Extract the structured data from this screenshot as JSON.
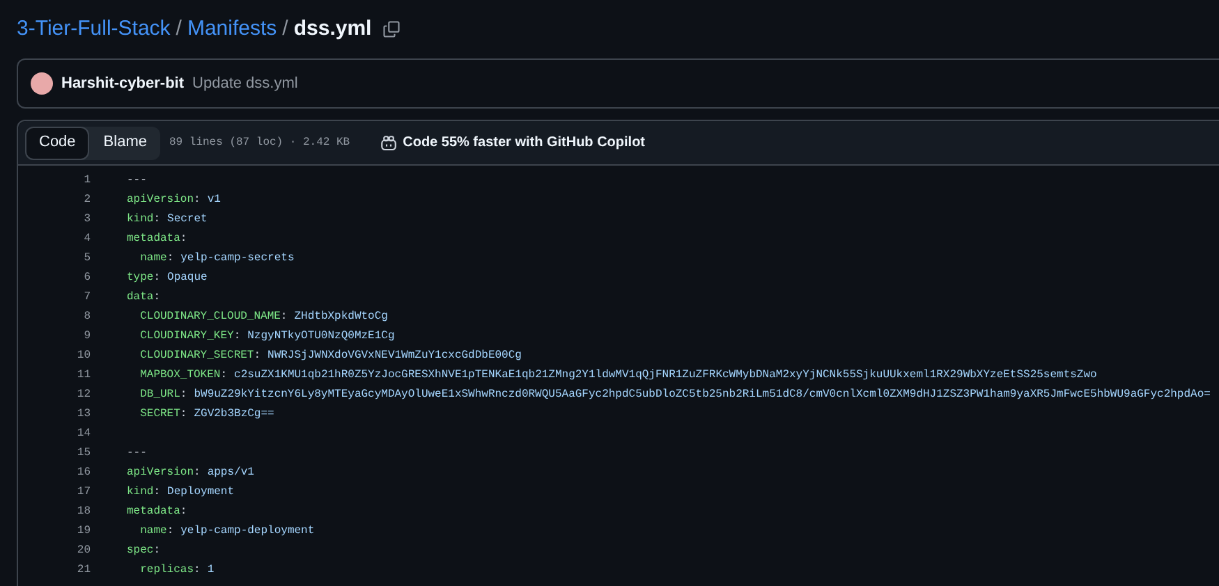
{
  "breadcrumb": [
    {
      "label": "3-Tier-Full-Stack",
      "kind": "link"
    },
    {
      "label": "/",
      "kind": "separator"
    },
    {
      "label": "Manifests",
      "kind": "link"
    },
    {
      "label": "/",
      "kind": "separator"
    },
    {
      "label": "dss.yml",
      "kind": "current"
    }
  ],
  "commit": {
    "author": "Harshit-cyber-bit",
    "message": "Update dss.yml"
  },
  "file_header": {
    "tabs": [
      {
        "label": "Code",
        "selected": true
      },
      {
        "label": "Blame",
        "selected": false
      }
    ],
    "info": "89 lines (87 loc) · 2.42 KB",
    "copilot": "Code 55% faster with GitHub Copilot"
  },
  "code_lines": [
    {
      "number": "1",
      "text": "---"
    },
    {
      "number": "2",
      "key": "apiVersion",
      "colon": ":",
      "value": "v1"
    },
    {
      "number": "3",
      "key": "kind",
      "colon": ":",
      "value": "Secret"
    },
    {
      "number": "4",
      "key": "metadata",
      "colon": ":"
    },
    {
      "number": "5",
      "key": "  name",
      "colon": ":",
      "value": "yelp-camp-secrets"
    },
    {
      "number": "6",
      "key": "type",
      "colon": ":",
      "value": "Opaque"
    },
    {
      "number": "7",
      "key": "data",
      "colon": ":"
    },
    {
      "number": "8",
      "key": "  CLOUDINARY_CLOUD_NAME",
      "colon": ":",
      "value": "ZHdtbXpkdWtoCg"
    },
    {
      "number": "9",
      "key": "  CLOUDINARY_KEY",
      "colon": ":",
      "value": "NzgyNTkyOTU0NzQ0MzE1Cg"
    },
    {
      "number": "10",
      "key": "  CLOUDINARY_SECRET",
      "colon": ":",
      "value": "NWRJSjJWNXdoVGVxNEV1WmZuY1cxcGdDbE00Cg"
    },
    {
      "number": "11",
      "key": "  MAPBOX_TOKEN",
      "colon": ":",
      "value": "c2suZX1KMU1qb21hR0Z5YzJocGRESXhNVE1pTENKaE1qb21ZMng2Y1ldwMV1qQjFNR1ZuZFRKcWMybDNaM2xyYjNCNk55SjkuUUkxeml1RX29WbXYzeEtSS25semtsZwo"
    },
    {
      "number": "12",
      "key": "  DB_URL",
      "colon": ":",
      "value": "bW9uZ29kYitzcnY6Ly8yMTEyaGcyMDAyOlUweE1xSWhwRnczd0RWQU5AaGFyc2hpdC5ubDloZC5tb25nb2RiLm51dC8/cmV0cnlXcml0ZXM9dHJ1ZSZ3PW1ham9yaXR5JmFwcE5hbWU9aGFyc2hpdAo="
    },
    {
      "number": "13",
      "key": "  SECRET",
      "colon": ":",
      "value": "ZGV2b3BzCg=="
    },
    {
      "number": "14"
    },
    {
      "number": "15",
      "text": "---"
    },
    {
      "number": "16",
      "key": "apiVersion",
      "colon": ":",
      "value": "apps/v1"
    },
    {
      "number": "17",
      "key": "kind",
      "colon": ":",
      "value": "Deployment"
    },
    {
      "number": "18",
      "key": "metadata",
      "colon": ":"
    },
    {
      "number": "19",
      "key": "  name",
      "colon": ":",
      "value": "yelp-camp-deployment"
    },
    {
      "number": "20",
      "key": "spec",
      "colon": ":"
    },
    {
      "number": "21",
      "key": "  replicas",
      "colon": ":",
      "value": "1"
    }
  ]
}
